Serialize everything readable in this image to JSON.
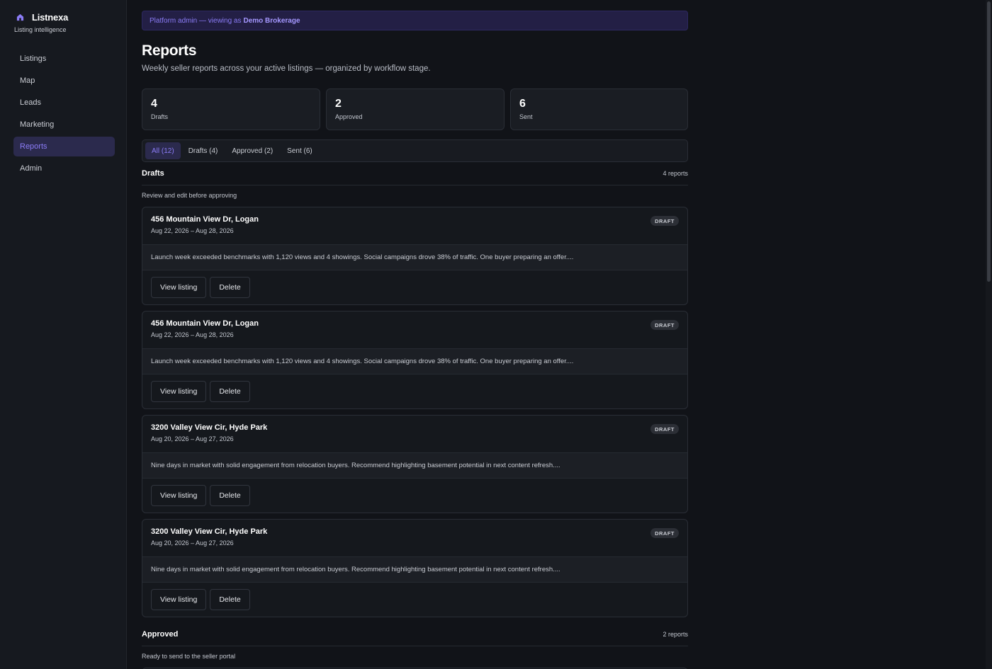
{
  "brand": {
    "name": "Listnexa",
    "tagline": "Listing intelligence"
  },
  "nav": [
    {
      "label": "Listings",
      "active": false
    },
    {
      "label": "Map",
      "active": false
    },
    {
      "label": "Leads",
      "active": false
    },
    {
      "label": "Marketing",
      "active": false
    },
    {
      "label": "Reports",
      "active": true
    },
    {
      "label": "Admin",
      "active": false
    }
  ],
  "banner": {
    "prefix": "Platform admin — viewing as",
    "org": "Demo Brokerage"
  },
  "page": {
    "title": "Reports",
    "subtitle": "Weekly seller reports across your active listings — organized by workflow stage."
  },
  "stats": [
    {
      "value": "4",
      "label": "Drafts"
    },
    {
      "value": "2",
      "label": "Approved"
    },
    {
      "value": "6",
      "label": "Sent"
    }
  ],
  "tabs": [
    {
      "label": "All (12)",
      "active": true
    },
    {
      "label": "Drafts (4)",
      "active": false
    },
    {
      "label": "Approved (2)",
      "active": false
    },
    {
      "label": "Sent (6)",
      "active": false
    }
  ],
  "drafts": {
    "title": "Drafts",
    "count": "4 reports",
    "subtitle": "Review and edit before approving",
    "cards": [
      {
        "address": "456 Mountain View Dr, Logan",
        "dates": "Aug 22, 2026 – Aug 28, 2026",
        "badge": "DRAFT",
        "summary": "Launch week exceeded benchmarks with 1,120 views and 4 showings. Social campaigns drove 38% of traffic. One buyer preparing an offer....",
        "view_label": "View listing",
        "delete_label": "Delete"
      },
      {
        "address": "456 Mountain View Dr, Logan",
        "dates": "Aug 22, 2026 – Aug 28, 2026",
        "badge": "DRAFT",
        "summary": "Launch week exceeded benchmarks with 1,120 views and 4 showings. Social campaigns drove 38% of traffic. One buyer preparing an offer....",
        "view_label": "View listing",
        "delete_label": "Delete"
      },
      {
        "address": "3200 Valley View Cir, Hyde Park",
        "dates": "Aug 20, 2026 – Aug 27, 2026",
        "badge": "DRAFT",
        "summary": "Nine days in market with solid engagement from relocation buyers. Recommend highlighting basement potential in next content refresh....",
        "view_label": "View listing",
        "delete_label": "Delete"
      },
      {
        "address": "3200 Valley View Cir, Hyde Park",
        "dates": "Aug 20, 2026 – Aug 27, 2026",
        "badge": "DRAFT",
        "summary": "Nine days in market with solid engagement from relocation buyers. Recommend highlighting basement potential in next content refresh....",
        "view_label": "View listing",
        "delete_label": "Delete"
      }
    ]
  },
  "approved": {
    "title": "Approved",
    "count": "2 reports",
    "subtitle": "Ready to send to the seller portal"
  },
  "colors": {
    "accent": "#8b7cf6",
    "background": "#111318",
    "sidebar": "#16191f"
  },
  "icons": {
    "brand": "house-icon"
  }
}
